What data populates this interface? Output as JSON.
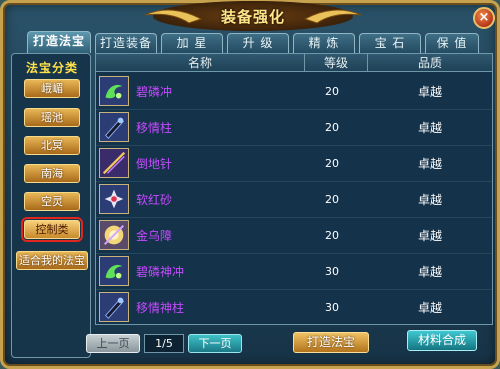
{
  "window": {
    "title": "装备强化",
    "close_glyph": "×"
  },
  "tabs": [
    {
      "label": "打造法宝",
      "active": true
    },
    {
      "label": "打造装备",
      "active": false
    },
    {
      "label": "加 星",
      "active": false
    },
    {
      "label": "升 级",
      "active": false
    },
    {
      "label": "精 炼",
      "active": false
    },
    {
      "label": "宝 石",
      "active": false
    },
    {
      "label": "保 值",
      "active": false
    }
  ],
  "sidebar": {
    "title": "法宝分类",
    "categories": [
      {
        "label": "峨嵋",
        "selected": false
      },
      {
        "label": "瑶池",
        "selected": false
      },
      {
        "label": "北冥",
        "selected": false
      },
      {
        "label": "南海",
        "selected": false
      },
      {
        "label": "空灵",
        "selected": false
      },
      {
        "label": "控制类",
        "selected": true
      },
      {
        "label": "适合我的法宝",
        "selected": false
      }
    ]
  },
  "table": {
    "columns": {
      "name": "名称",
      "level": "等级",
      "quality": "品质"
    },
    "rows": [
      {
        "name": "碧磷冲",
        "level": "20",
        "quality": "卓越",
        "icon": "green-swirl-icon"
      },
      {
        "name": "移情柱",
        "level": "20",
        "quality": "卓越",
        "icon": "dark-pillar-icon"
      },
      {
        "name": "倒地针",
        "level": "20",
        "quality": "卓越",
        "icon": "golden-needle-icon"
      },
      {
        "name": "软红砂",
        "level": "20",
        "quality": "卓越",
        "icon": "red-sand-icon"
      },
      {
        "name": "金乌障",
        "level": "20",
        "quality": "卓越",
        "icon": "golden-shield-icon"
      },
      {
        "name": "碧磷神冲",
        "level": "30",
        "quality": "卓越",
        "icon": "green-swirl-icon"
      },
      {
        "name": "移情神柱",
        "level": "30",
        "quality": "卓越",
        "icon": "dark-pillar-icon"
      }
    ]
  },
  "pagination": {
    "prev_label": "上一页",
    "page_indicator": "1/5",
    "next_label": "下一页"
  },
  "actions": {
    "forge_label": "打造法宝",
    "compose_label": "材料合成"
  },
  "colors": {
    "item_name": "#c54bff",
    "sidebar_title": "#ffe14a",
    "title": "#ffe68a",
    "selected_outline": "#e0261e"
  }
}
